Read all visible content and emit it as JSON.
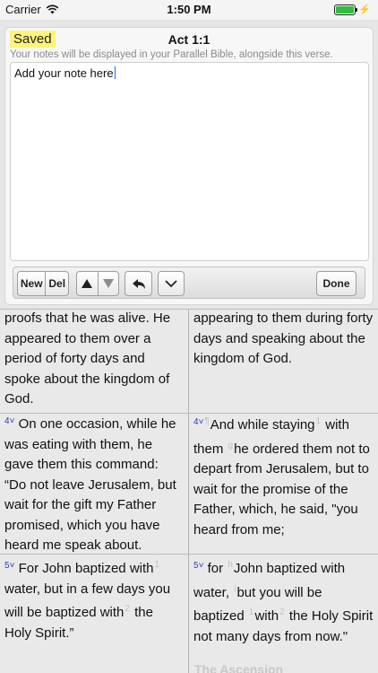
{
  "status": {
    "carrier": "Carrier",
    "time": "1:50 PM",
    "battery_color": "#2fbf3f"
  },
  "note": {
    "saved": "Saved",
    "title": "Act 1:1",
    "hint": "Your notes will be displayed in your Parallel Bible, alongside this verse.",
    "body": "Add your note here",
    "toolbar": {
      "new": "New",
      "del": "Del",
      "done": "Done"
    }
  },
  "bible": {
    "left": {
      "v3": "proofs that he was alive. He appeared to them over a period of forty days and spoke about the kingdom of God.",
      "v4_num": "4",
      "v4": "On one occasion, while he was eating with them, he gave them this command: “Do not leave Jerusalem, but wait for the gift my Father promised, which you have heard me speak about.",
      "v5_num": "5",
      "v5a": "For John baptized with",
      "v5a_sup": "1",
      "v5b": "water, but in a few days you will be baptized with",
      "v5b_sup": "2",
      "v5c": "the Holy Spirit.”"
    },
    "right": {
      "v3": "appearing to them during forty days and speaking about the kingdom of God.",
      "v4_num": "4",
      "v4_mark": "¶",
      "v4a": "And while staying",
      "v4a_sup": "1",
      "v4b": "with them",
      "v4b_sup": "g",
      "v4c": "he ordered them not to depart from Jerusalem, but to wait for the promise of the Father, which, he said, \"you heard from me;",
      "v5_num": "5",
      "v5a": "for",
      "v5a_sup": "h",
      "v5b": "John baptized with water,",
      "v5b_sup": "i",
      "v5c": "but you will be baptized",
      "v5c_sup": "1",
      "v5d": "with",
      "v5d_sup": "2",
      "v5e": "the Holy Spirit not many days from now.\"",
      "heading": "The Ascension"
    }
  }
}
